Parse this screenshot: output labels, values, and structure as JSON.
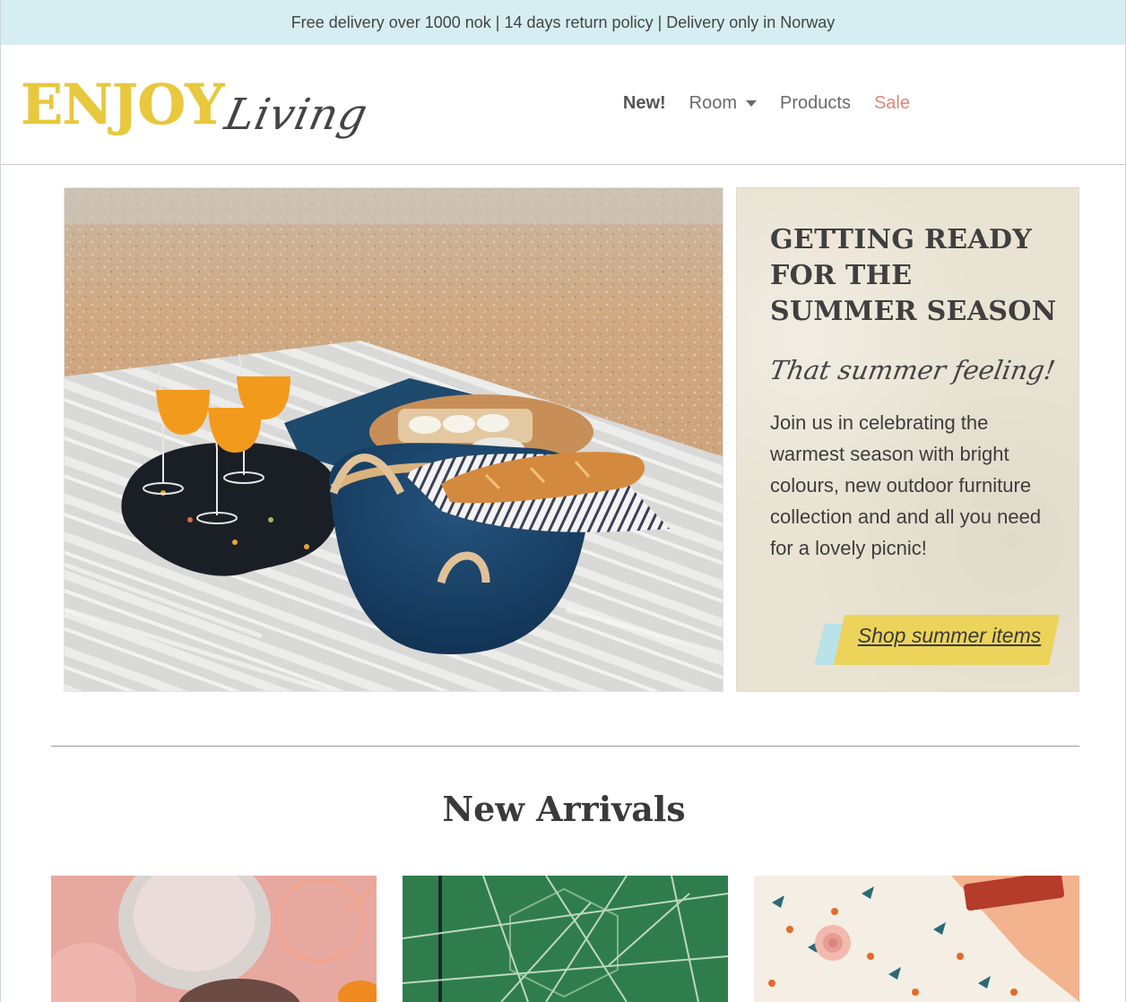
{
  "topbar": {
    "text": "Free delivery over 1000 nok | 14 days return policy | Delivery only in Norway"
  },
  "logo": {
    "main": "ENJOY",
    "script": "Living"
  },
  "nav": {
    "items": [
      {
        "label": "New!"
      },
      {
        "label": "Room"
      },
      {
        "label": "Products"
      },
      {
        "label": "Sale"
      }
    ]
  },
  "hero": {
    "title": "GETTING READY FOR THE SUMMER SEASON",
    "script": "That summer feeling!",
    "text": "Join us in celebrating the warmest season with bright colours, new outdoor furniture collection and and all you need for a lovely picnic!",
    "button": "Shop summer items"
  },
  "section": {
    "title": "New Arrivals"
  },
  "colors": {
    "topbar_bg": "#d6eef1",
    "logo_yellow": "#e8c83c",
    "sale": "#d98a77",
    "panel_bg": "#e9e3d3",
    "button_yellow": "#ecd35a",
    "button_blue": "#b9e3e8"
  }
}
